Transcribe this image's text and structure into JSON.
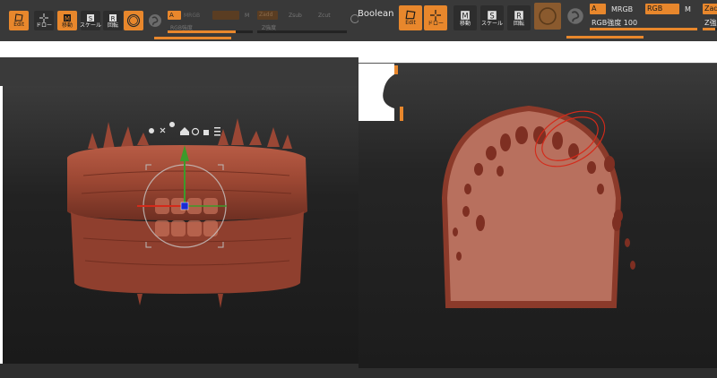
{
  "left_toolbar": {
    "edit": "Edit",
    "draw": "ドロー",
    "move": "移動",
    "scale": "スケール",
    "rotate": "回転",
    "a_chip": "A",
    "mrgb": "MRGB",
    "m": "M",
    "zadd": "Zadd",
    "zsub": "Zsub",
    "zcut": "Zcut",
    "rgb_strength": "RGB強度",
    "z_strength": "Z強度",
    "boolean": "Boolean"
  },
  "right_toolbar": {
    "edit": "Edit",
    "draw": "ドロー",
    "move": "移動",
    "scale": "スケール",
    "rotate": "回転",
    "a_chip": "A",
    "mrgb": "MRGB",
    "rgb": "RGB",
    "m": "M",
    "zadd": "Zadd",
    "rgb_strength_label": "RGB強度",
    "rgb_strength_value": "100",
    "z_strength": "Z強度"
  },
  "sliders": {
    "left_rgb_strength": 0.8,
    "right_rgb_strength": 1.0,
    "right_z_strength": 0.9
  },
  "colors": {
    "accent": "#e8872c",
    "toolbar_bg": "#393939",
    "model": "#a04a36",
    "gizmo_green": "#3d9a2b",
    "gizmo_red": "#d42a1a",
    "gizmo_blue": "#1a2bd4"
  },
  "icons": {
    "gizmo_toolbar": [
      "gear-icon",
      "pin-icon",
      "location-icon",
      "home-icon",
      "reset-icon",
      "lock-icon",
      "list-icon"
    ]
  }
}
